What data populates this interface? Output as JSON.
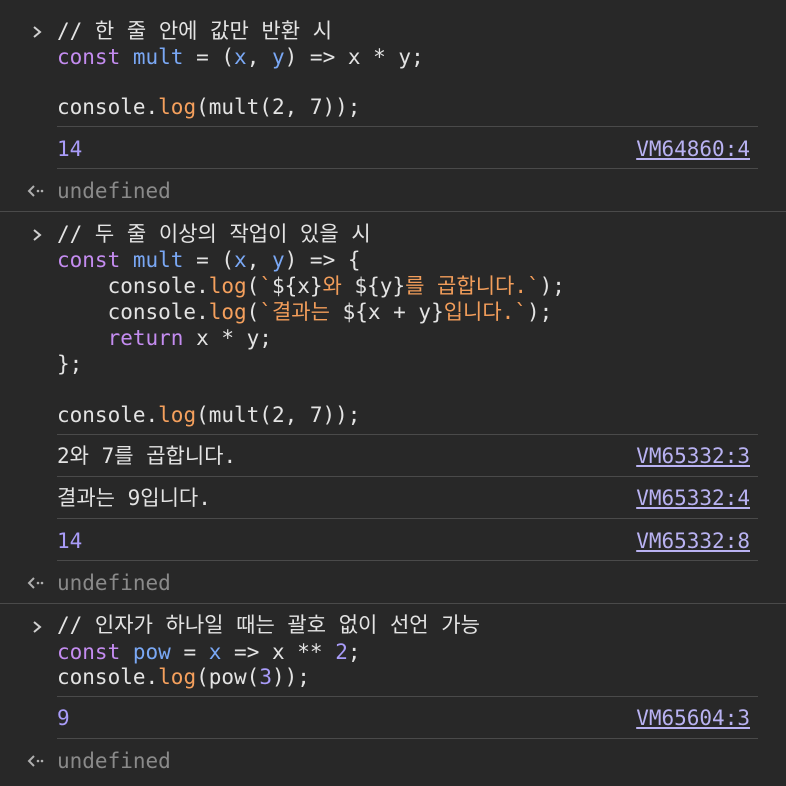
{
  "input_blocks": [
    {
      "comment": "// 한 줄 안에 값만 반환 시",
      "lines": [
        [
          [
            "kw",
            "const"
          ],
          [
            "p",
            " "
          ],
          [
            "var",
            "mult"
          ],
          [
            "p",
            " = ("
          ],
          [
            "var",
            "x"
          ],
          [
            "p",
            ", "
          ],
          [
            "var",
            "y"
          ],
          [
            "p",
            ") => x * y;"
          ]
        ],
        [],
        [
          [
            "p",
            "console."
          ],
          [
            "fn",
            "log"
          ],
          [
            "p",
            "(mult(2, 7));"
          ]
        ]
      ]
    },
    {
      "comment": "// 두 줄 이상의 작업이 있을 시",
      "lines": [
        [
          [
            "kw",
            "const"
          ],
          [
            "p",
            " "
          ],
          [
            "var",
            "mult"
          ],
          [
            "p",
            " = ("
          ],
          [
            "var",
            "x"
          ],
          [
            "p",
            ", "
          ],
          [
            "var",
            "y"
          ],
          [
            "p",
            ") => {"
          ]
        ],
        [
          [
            "p",
            "    console."
          ],
          [
            "fn",
            "log"
          ],
          [
            "p",
            "("
          ],
          [
            "str",
            "`"
          ],
          [
            "p",
            "${x}"
          ],
          [
            "str",
            "와 "
          ],
          [
            "p",
            "${y}"
          ],
          [
            "str",
            "를 곱합니다.`"
          ],
          [
            "p",
            ");"
          ]
        ],
        [
          [
            "p",
            "    console."
          ],
          [
            "fn",
            "log"
          ],
          [
            "p",
            "("
          ],
          [
            "str",
            "`결과는 "
          ],
          [
            "p",
            "${x + y}"
          ],
          [
            "str",
            "입니다.`"
          ],
          [
            "p",
            ");"
          ]
        ],
        [
          [
            "p",
            "    "
          ],
          [
            "kw",
            "return"
          ],
          [
            "p",
            " x * y;"
          ]
        ],
        [
          [
            "p",
            "};"
          ]
        ],
        [],
        [
          [
            "p",
            "console."
          ],
          [
            "fn",
            "log"
          ],
          [
            "p",
            "(mult(2, 7));"
          ]
        ]
      ]
    },
    {
      "comment": "// 인자가 하나일 때는 괄호 없이 선언 가능",
      "lines": [
        [
          [
            "kw",
            "const"
          ],
          [
            "p",
            " "
          ],
          [
            "var",
            "pow"
          ],
          [
            "p",
            " = "
          ],
          [
            "var",
            "x"
          ],
          [
            "p",
            " => x ** "
          ],
          [
            "num",
            "2"
          ],
          [
            "p",
            ";"
          ]
        ],
        [
          [
            "p",
            "console."
          ],
          [
            "fn",
            "log"
          ],
          [
            "p",
            "(pow("
          ],
          [
            "num",
            "3"
          ],
          [
            "p",
            "));"
          ]
        ]
      ]
    }
  ],
  "outputs": [
    {
      "text": "14",
      "link": "VM64860:4",
      "numeric": true
    },
    {
      "text": "2와 7를 곱합니다.",
      "link": "VM65332:3",
      "numeric": false
    },
    {
      "text": "결과는 9입니다.",
      "link": "VM65332:4",
      "numeric": false
    },
    {
      "text": "14",
      "link": "VM65332:8",
      "numeric": true
    },
    {
      "text": "9",
      "link": "VM65604:3",
      "numeric": true
    }
  ],
  "returns": [
    "undefined",
    "undefined",
    "undefined"
  ],
  "icons": {
    "prompt": "chevron-right-icon",
    "return": "return-arrow-icon"
  },
  "colors": {
    "background": "#282828",
    "keyword": "#c48cf0",
    "variable": "#7aa8f5",
    "function": "#f5a05d",
    "string": "#f29d5a",
    "number": "#a99cf9",
    "link": "#b9b2f2",
    "undefined": "#8a8a8a",
    "separator": "#4a4a4a"
  }
}
